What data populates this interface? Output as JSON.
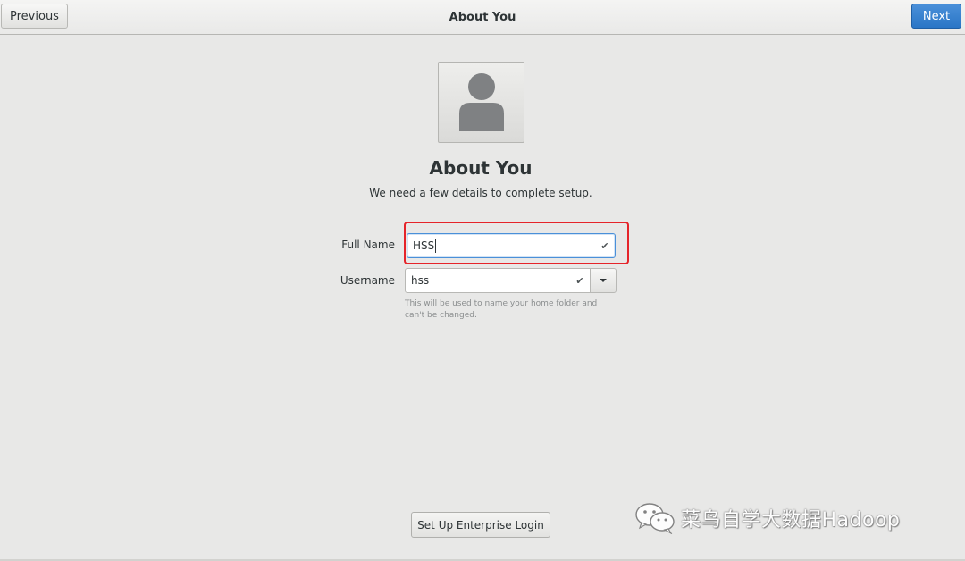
{
  "header": {
    "title": "About You",
    "previous_label": "Previous",
    "next_label": "Next"
  },
  "page": {
    "title": "About You",
    "subtitle": "We need a few details to complete setup."
  },
  "form": {
    "full_name_label": "Full Name",
    "full_name_value": "HSS",
    "username_label": "Username",
    "username_value": "hss",
    "username_hint": "This will be used to name your home folder and can't be changed."
  },
  "footer": {
    "enterprise_login_label": "Set Up Enterprise Login"
  },
  "watermark": {
    "text": "菜鸟自学大数据Hadoop"
  },
  "icons": {
    "avatar": "user-avatar-icon",
    "check": "checkmark-icon",
    "dropdown": "chevron-down-icon",
    "watermark_logo": "wechat-logo-icon"
  },
  "colors": {
    "accent": "#4a90d9",
    "next_button": "#2a76c6",
    "highlight": "#e5242a",
    "background": "#e8e8e7"
  }
}
